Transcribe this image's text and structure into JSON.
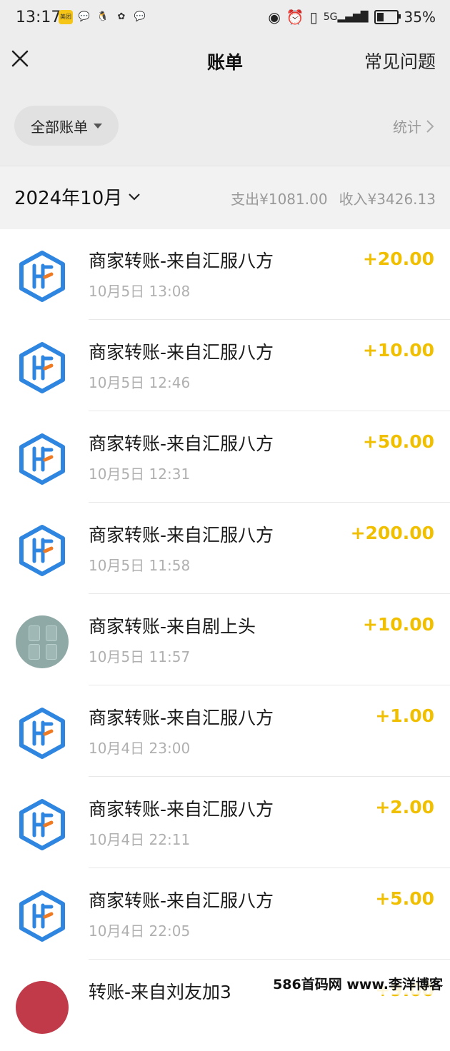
{
  "status_bar": {
    "time": "13:17",
    "apps": [
      "meituan-icon",
      "wechat-icon",
      "qq-icon",
      "pinwheel-icon",
      "wechat-icon"
    ],
    "meituan_text": "美团",
    "battery": "35%",
    "battery_level": 0.35
  },
  "nav": {
    "title": "账单",
    "faq": "常见问题"
  },
  "filter": {
    "all_bills": "全部账单",
    "stats": "统计"
  },
  "month": {
    "label": "2024年10月",
    "expense": "支出¥1081.00",
    "income": "收入¥3426.13"
  },
  "transactions": [
    {
      "title": "商家转账-来自汇服八方",
      "time": "10月5日 13:08",
      "amount": "+20.00",
      "avatar": "hf-logo"
    },
    {
      "title": "商家转账-来自汇服八方",
      "time": "10月5日 12:46",
      "amount": "+10.00",
      "avatar": "hf-logo"
    },
    {
      "title": "商家转账-来自汇服八方",
      "time": "10月5日 12:31",
      "amount": "+50.00",
      "avatar": "hf-logo"
    },
    {
      "title": "商家转账-来自汇服八方",
      "time": "10月5日 11:58",
      "amount": "+200.00",
      "avatar": "hf-logo"
    },
    {
      "title": "商家转账-来自剧上头",
      "time": "10月5日 11:57",
      "amount": "+10.00",
      "avatar": "photo"
    },
    {
      "title": "商家转账-来自汇服八方",
      "time": "10月4日 23:00",
      "amount": "+1.00",
      "avatar": "hf-logo"
    },
    {
      "title": "商家转账-来自汇服八方",
      "time": "10月4日 22:11",
      "amount": "+2.00",
      "avatar": "hf-logo"
    },
    {
      "title": "商家转账-来自汇服八方",
      "time": "10月4日 22:05",
      "amount": "+5.00",
      "avatar": "hf-logo"
    },
    {
      "title": "转账-来自刘友加3",
      "time": "",
      "amount": "+9.00",
      "avatar": "person"
    }
  ],
  "watermark": "586首码网 www.李洋博客",
  "colors": {
    "income_amount": "#f0c000",
    "hf_blue": "#2f86e0",
    "hf_orange": "#f07a22",
    "header_bg": "#ededed"
  }
}
